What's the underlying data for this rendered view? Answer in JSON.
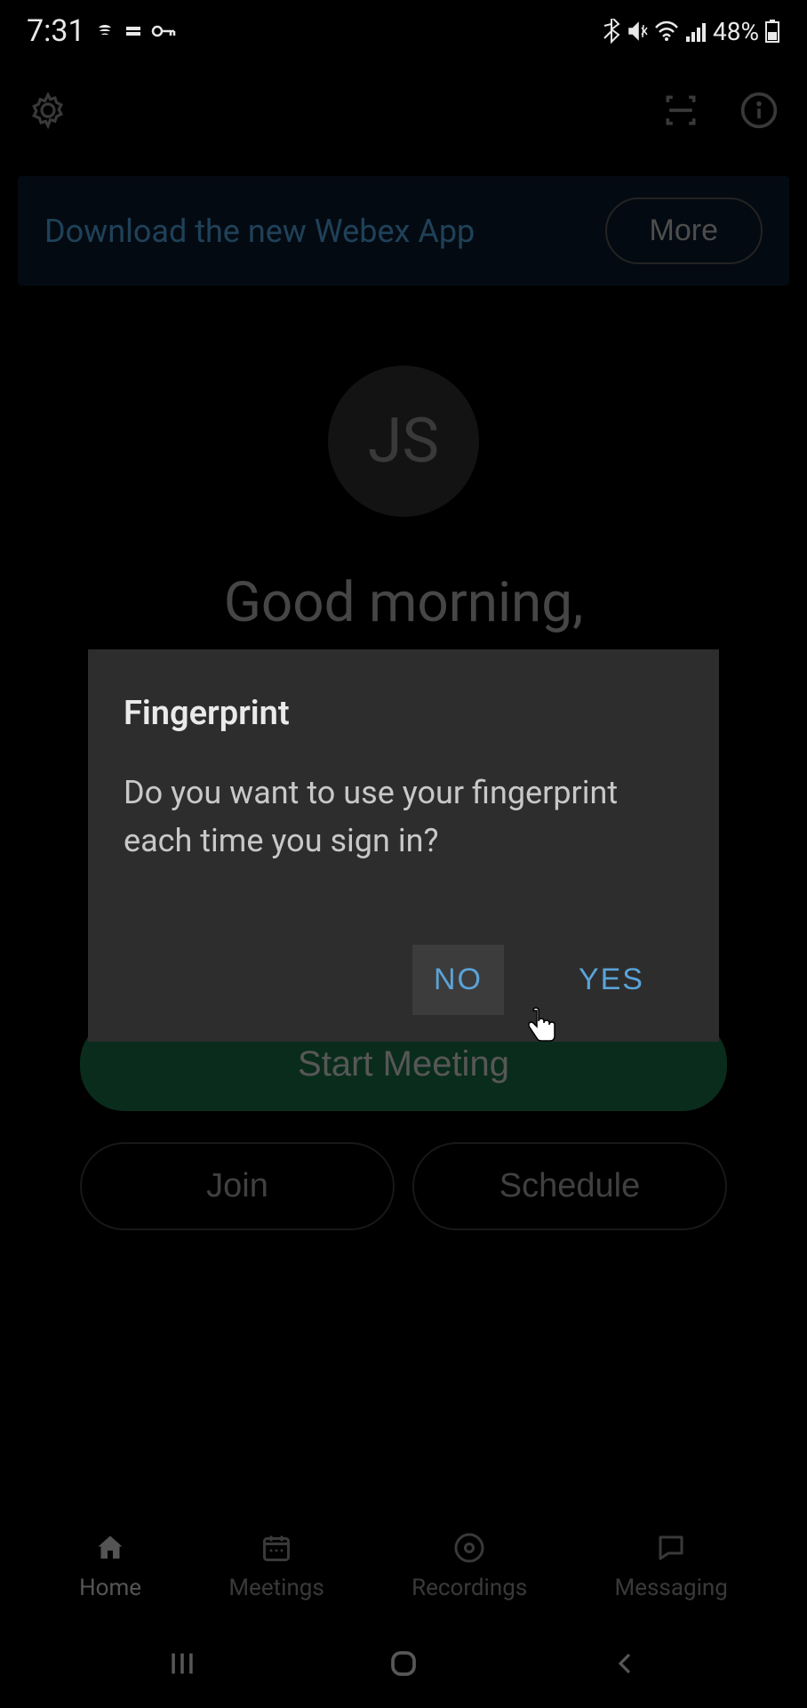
{
  "status_bar": {
    "time": "7:31",
    "battery_percent": "48%"
  },
  "top_bar": {
    "settings_icon": "settings",
    "scan_icon": "scan",
    "info_icon": "info"
  },
  "banner": {
    "text": "Download the new Webex App",
    "more_label": "More"
  },
  "avatar": {
    "initials": "JS"
  },
  "greeting": "Good morning,",
  "actions": {
    "start_meeting": "Start Meeting",
    "join": "Join",
    "schedule": "Schedule"
  },
  "bottom_nav": {
    "home": "Home",
    "meetings": "Meetings",
    "recordings": "Recordings",
    "messaging": "Messaging"
  },
  "dialog": {
    "title": "Fingerprint",
    "message": "Do you want to use your fingerprint each time you sign in?",
    "no": "NO",
    "yes": "YES"
  }
}
